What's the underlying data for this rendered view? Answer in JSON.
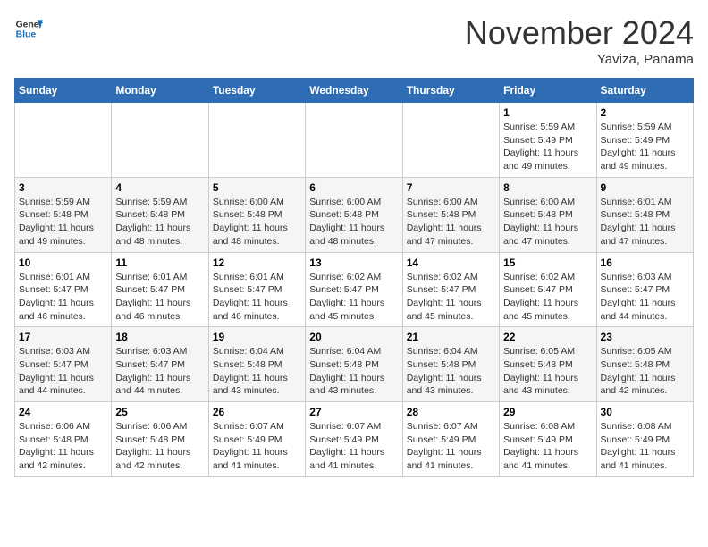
{
  "logo": {
    "general": "General",
    "blue": "Blue"
  },
  "header": {
    "title": "November 2024",
    "location": "Yaviza, Panama"
  },
  "weekdays": [
    "Sunday",
    "Monday",
    "Tuesday",
    "Wednesday",
    "Thursday",
    "Friday",
    "Saturday"
  ],
  "weeks": [
    [
      {
        "day": "",
        "info": ""
      },
      {
        "day": "",
        "info": ""
      },
      {
        "day": "",
        "info": ""
      },
      {
        "day": "",
        "info": ""
      },
      {
        "day": "",
        "info": ""
      },
      {
        "day": "1",
        "info": "Sunrise: 5:59 AM\nSunset: 5:49 PM\nDaylight: 11 hours and 49 minutes."
      },
      {
        "day": "2",
        "info": "Sunrise: 5:59 AM\nSunset: 5:49 PM\nDaylight: 11 hours and 49 minutes."
      }
    ],
    [
      {
        "day": "3",
        "info": "Sunrise: 5:59 AM\nSunset: 5:48 PM\nDaylight: 11 hours and 49 minutes."
      },
      {
        "day": "4",
        "info": "Sunrise: 5:59 AM\nSunset: 5:48 PM\nDaylight: 11 hours and 48 minutes."
      },
      {
        "day": "5",
        "info": "Sunrise: 6:00 AM\nSunset: 5:48 PM\nDaylight: 11 hours and 48 minutes."
      },
      {
        "day": "6",
        "info": "Sunrise: 6:00 AM\nSunset: 5:48 PM\nDaylight: 11 hours and 48 minutes."
      },
      {
        "day": "7",
        "info": "Sunrise: 6:00 AM\nSunset: 5:48 PM\nDaylight: 11 hours and 47 minutes."
      },
      {
        "day": "8",
        "info": "Sunrise: 6:00 AM\nSunset: 5:48 PM\nDaylight: 11 hours and 47 minutes."
      },
      {
        "day": "9",
        "info": "Sunrise: 6:01 AM\nSunset: 5:48 PM\nDaylight: 11 hours and 47 minutes."
      }
    ],
    [
      {
        "day": "10",
        "info": "Sunrise: 6:01 AM\nSunset: 5:47 PM\nDaylight: 11 hours and 46 minutes."
      },
      {
        "day": "11",
        "info": "Sunrise: 6:01 AM\nSunset: 5:47 PM\nDaylight: 11 hours and 46 minutes."
      },
      {
        "day": "12",
        "info": "Sunrise: 6:01 AM\nSunset: 5:47 PM\nDaylight: 11 hours and 46 minutes."
      },
      {
        "day": "13",
        "info": "Sunrise: 6:02 AM\nSunset: 5:47 PM\nDaylight: 11 hours and 45 minutes."
      },
      {
        "day": "14",
        "info": "Sunrise: 6:02 AM\nSunset: 5:47 PM\nDaylight: 11 hours and 45 minutes."
      },
      {
        "day": "15",
        "info": "Sunrise: 6:02 AM\nSunset: 5:47 PM\nDaylight: 11 hours and 45 minutes."
      },
      {
        "day": "16",
        "info": "Sunrise: 6:03 AM\nSunset: 5:47 PM\nDaylight: 11 hours and 44 minutes."
      }
    ],
    [
      {
        "day": "17",
        "info": "Sunrise: 6:03 AM\nSunset: 5:47 PM\nDaylight: 11 hours and 44 minutes."
      },
      {
        "day": "18",
        "info": "Sunrise: 6:03 AM\nSunset: 5:47 PM\nDaylight: 11 hours and 44 minutes."
      },
      {
        "day": "19",
        "info": "Sunrise: 6:04 AM\nSunset: 5:48 PM\nDaylight: 11 hours and 43 minutes."
      },
      {
        "day": "20",
        "info": "Sunrise: 6:04 AM\nSunset: 5:48 PM\nDaylight: 11 hours and 43 minutes."
      },
      {
        "day": "21",
        "info": "Sunrise: 6:04 AM\nSunset: 5:48 PM\nDaylight: 11 hours and 43 minutes."
      },
      {
        "day": "22",
        "info": "Sunrise: 6:05 AM\nSunset: 5:48 PM\nDaylight: 11 hours and 43 minutes."
      },
      {
        "day": "23",
        "info": "Sunrise: 6:05 AM\nSunset: 5:48 PM\nDaylight: 11 hours and 42 minutes."
      }
    ],
    [
      {
        "day": "24",
        "info": "Sunrise: 6:06 AM\nSunset: 5:48 PM\nDaylight: 11 hours and 42 minutes."
      },
      {
        "day": "25",
        "info": "Sunrise: 6:06 AM\nSunset: 5:48 PM\nDaylight: 11 hours and 42 minutes."
      },
      {
        "day": "26",
        "info": "Sunrise: 6:07 AM\nSunset: 5:49 PM\nDaylight: 11 hours and 41 minutes."
      },
      {
        "day": "27",
        "info": "Sunrise: 6:07 AM\nSunset: 5:49 PM\nDaylight: 11 hours and 41 minutes."
      },
      {
        "day": "28",
        "info": "Sunrise: 6:07 AM\nSunset: 5:49 PM\nDaylight: 11 hours and 41 minutes."
      },
      {
        "day": "29",
        "info": "Sunrise: 6:08 AM\nSunset: 5:49 PM\nDaylight: 11 hours and 41 minutes."
      },
      {
        "day": "30",
        "info": "Sunrise: 6:08 AM\nSunset: 5:49 PM\nDaylight: 11 hours and 41 minutes."
      }
    ]
  ]
}
